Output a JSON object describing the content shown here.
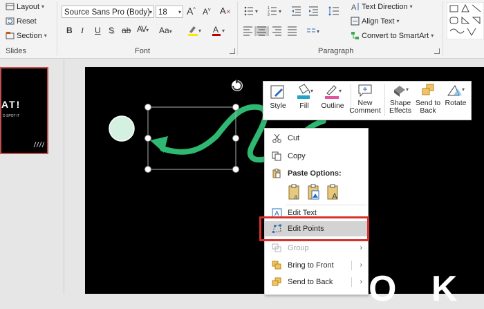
{
  "ribbon": {
    "slides": {
      "layout_label": "Layout",
      "reset_label": "Reset",
      "section_label": "Section",
      "group_label": "Slides"
    },
    "font": {
      "font_name": "Source Sans Pro (Body)",
      "font_size": "18",
      "bold": "B",
      "italic": "I",
      "underline": "U",
      "shadow": "S",
      "strike": "ab",
      "spacing": "AV",
      "case": "Aa",
      "group_label": "Font"
    },
    "paragraph": {
      "text_direction_label": "Text Direction",
      "align_text_label": "Align Text",
      "smartart_label": "Convert to SmartArt",
      "group_label": "Paragraph"
    }
  },
  "thumbnail": {
    "title_fragment": "AT!",
    "subtitle_fragment": "D SPOT IT"
  },
  "mini_toolbar": {
    "style_label": "Style",
    "fill_label": "Fill",
    "outline_label": "Outline",
    "new_comment_label": [
      "New",
      "Comment"
    ],
    "shape_effects_label": [
      "Shape",
      "Effects"
    ],
    "send_to_back_label": [
      "Send to",
      "Back"
    ],
    "rotate_label": "Rotate"
  },
  "context_menu": {
    "cut": "Cut",
    "copy": "Copy",
    "paste_options": "Paste Options:",
    "edit_text": "Edit Text",
    "edit_points": "Edit Points",
    "group": "Group",
    "bring_to_front": "Bring to Front",
    "send_to_back": "Send to Back"
  },
  "slide_text_fragment": "O K",
  "colors": {
    "accent_green": "#2eb872",
    "circle_fill": "#d4f0e0",
    "highlight_red": "#d9302a",
    "fill_teal": "#1fa6c8",
    "outline_pink": "#e0559b",
    "font_red": "#c00000",
    "highlighter_yellow": "#ffe600"
  }
}
